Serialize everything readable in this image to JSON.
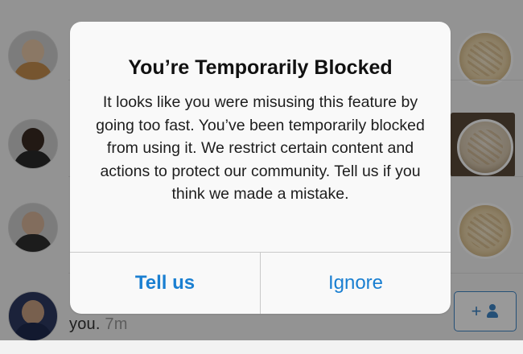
{
  "background": {
    "visible_text": {
      "caption": "you.",
      "time": "7m"
    }
  },
  "dialog": {
    "title": "You’re Temporarily Blocked",
    "message": "It looks like you were misusing this feature by going too fast. You’ve been temporarily blocked from using it. We restrict certain content and actions to protect our community. Tell us if you think we made a mistake.",
    "buttons": {
      "tell_us": "Tell us",
      "ignore": "Ignore"
    }
  },
  "colors": {
    "accent": "#1a7fd1",
    "dim_overlay": "rgba(0,0,0,0.40)"
  },
  "icons": {
    "follow": "add-person-icon"
  }
}
